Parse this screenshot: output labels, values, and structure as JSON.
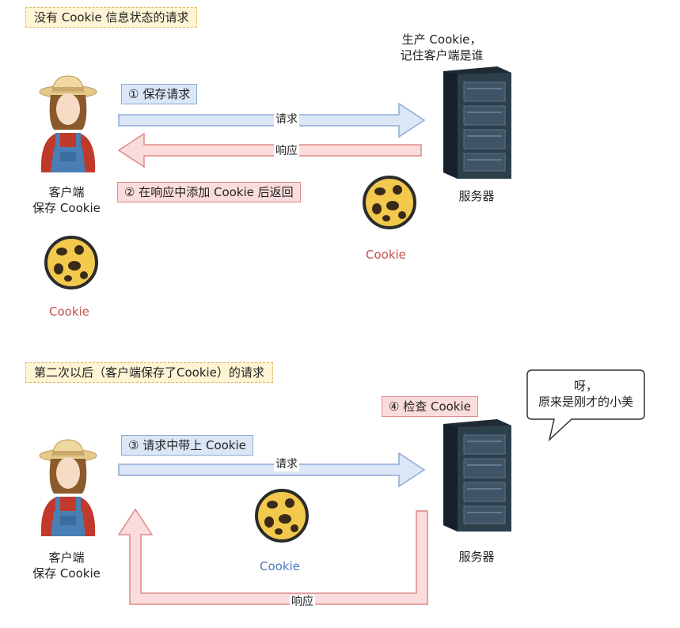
{
  "top": {
    "note": "没有 Cookie 信息状态的请求",
    "server_caption_line1": "生产 Cookie，",
    "server_caption_line2": "记住客户端是谁",
    "step1": "① 保存请求",
    "request_label": "请求",
    "response_label": "响应",
    "step2": "② 在响应中添加 Cookie 后返回",
    "client_label_line1": "客户端",
    "client_label_line2": "保存 Cookie",
    "server_label": "服务器",
    "cookie_mid_label": "Cookie",
    "cookie_left_label": "Cookie"
  },
  "bottom": {
    "note": "第二次以后（客户端保存了Cookie）的请求",
    "step4": "④ 检查 Cookie",
    "bubble_line1": "呀，",
    "bubble_line2": "原来是刚才的小美",
    "step3": "③ 请求中带上 Cookie",
    "request_label": "请求",
    "response_label": "响应",
    "client_label_line1": "客户端",
    "client_label_line2": "保存 Cookie",
    "server_label": "服务器",
    "cookie_label": "Cookie"
  },
  "colors": {
    "request_arrow_fill": "#dbe7f7",
    "request_arrow_stroke": "#8eaad4",
    "response_arrow_fill": "#fbdcdc",
    "response_arrow_stroke": "#dd8a8a",
    "cookie_red_text": "#c0504d",
    "cookie_blue_text": "#4a78c0"
  }
}
